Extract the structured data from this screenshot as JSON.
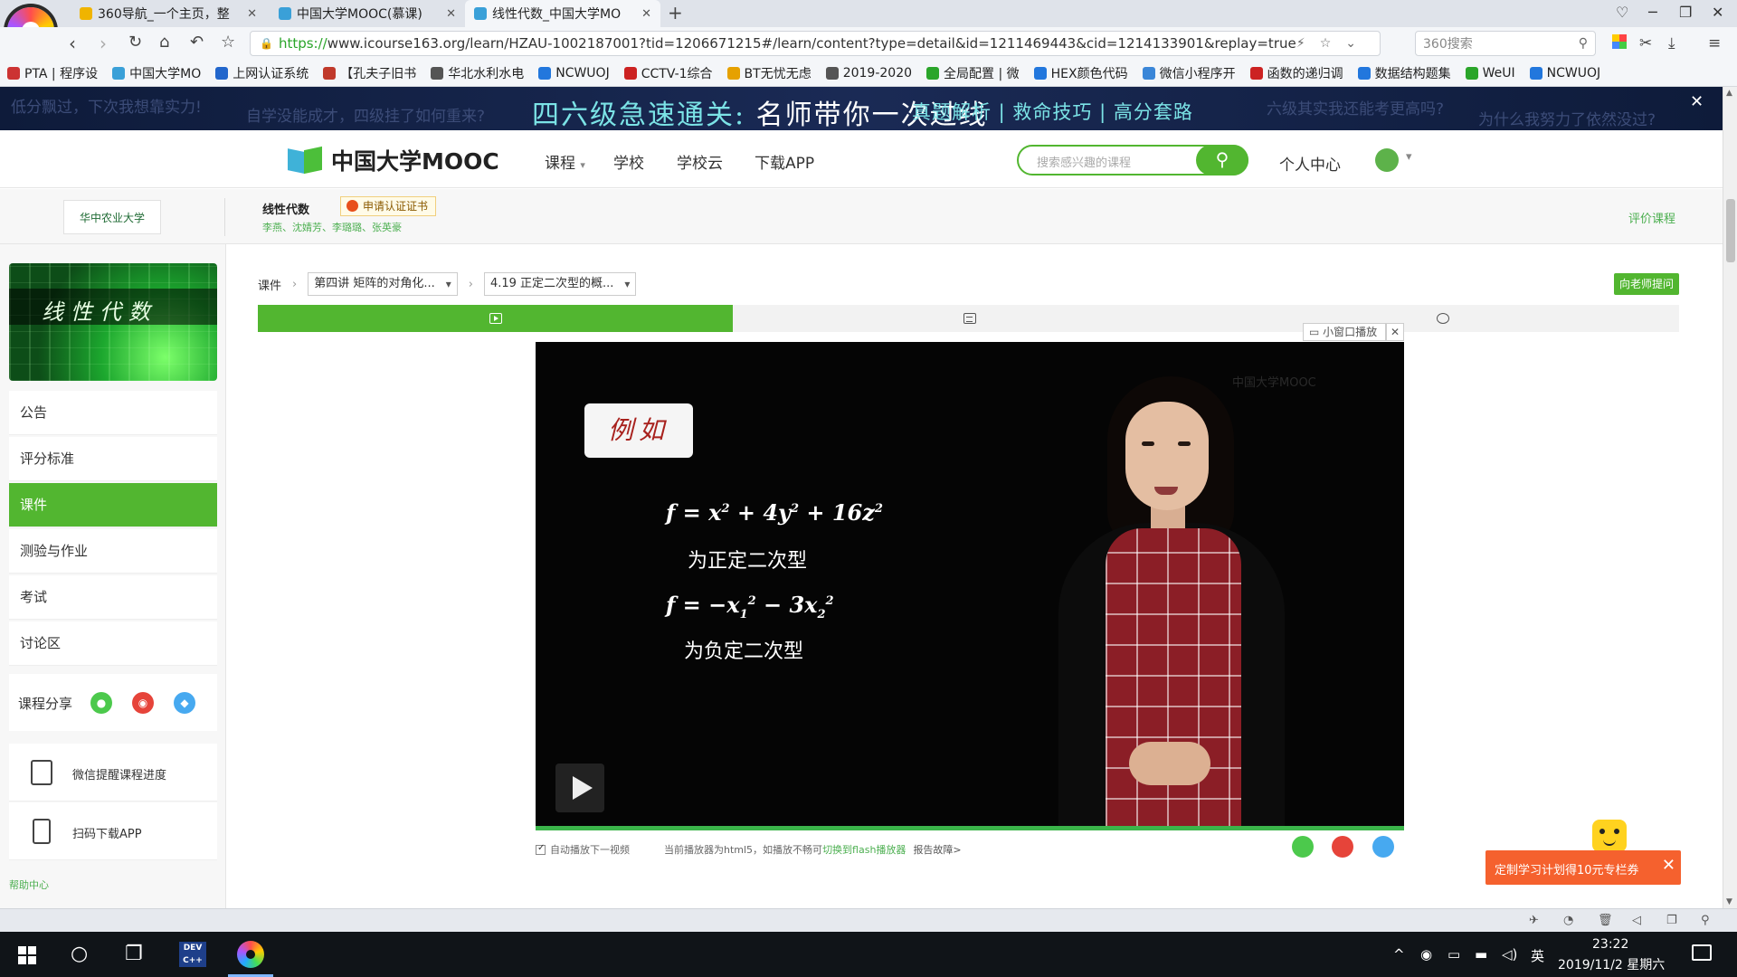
{
  "browser": {
    "tabs": [
      {
        "title": "360导航_一个主页，整",
        "active": false,
        "color": "#f0b400"
      },
      {
        "title": "中国大学MOOC(慕课)",
        "active": false,
        "color": "#3aa0d8"
      },
      {
        "title": "线性代数_中国大学MO",
        "active": true,
        "color": "#3aa0d8"
      }
    ],
    "new_tab": "+",
    "url_protocol": "https://",
    "url_rest": "www.icourse163.org/learn/HZAU-1002187001?tid=1206671215#/learn/content?type=detail&id=1211469443&cid=1214133901&replay=true",
    "search_placeholder": "360搜索",
    "bookmarks": [
      {
        "label": "PTA | 程序设",
        "color": "#cc3333"
      },
      {
        "label": "中国大学MO",
        "color": "#3aa0d8"
      },
      {
        "label": "上网认证系统",
        "color": "#2266cc"
      },
      {
        "label": "【孔夫子旧书",
        "color": "#c0392b"
      },
      {
        "label": "华北水利水电",
        "color": "#555555"
      },
      {
        "label": "NCWUOJ",
        "color": "#2277dd"
      },
      {
        "label": "CCTV-1综合",
        "color": "#cc2222"
      },
      {
        "label": "BT无忧无虑",
        "color": "#e6a100"
      },
      {
        "label": "2019-2020",
        "color": "#555555"
      },
      {
        "label": "全局配置 | 微",
        "color": "#2aa52a"
      },
      {
        "label": "HEX颜色代码",
        "color": "#2277dd"
      },
      {
        "label": "微信小程序开",
        "color": "#3a86d8"
      },
      {
        "label": "函数的递归调",
        "color": "#cc2222"
      },
      {
        "label": "数据结构题集",
        "color": "#2277dd"
      },
      {
        "label": "WeUI",
        "color": "#2aa52a"
      },
      {
        "label": "NCWUOJ",
        "color": "#2277dd"
      }
    ]
  },
  "ad": {
    "main_left": "四六级急速通关:",
    "main_right": "名师带你一次过线",
    "sub": "真题解析 | 救命技巧 | 高分套路",
    "floats": [
      "低分飘过，下次我想靠实力!",
      "自学没能成才，四级挂了如何重来?",
      "六级其实我还能考更高吗?",
      "为什么我努力了依然没过?"
    ],
    "close": "✕"
  },
  "header": {
    "logo_text": "中国大学MOOC",
    "nav": [
      "课程",
      "学校",
      "学校云",
      "下载APP"
    ],
    "search_placeholder": "搜索感兴趣的课程",
    "personal": "个人中心"
  },
  "course": {
    "school": "华中农业大学",
    "name": "线性代数",
    "cert_button": "申请认证证书",
    "teachers": "李燕、沈婧芳、李璐璐、张英豪",
    "rate": "评价课程",
    "cover_title": "线性代数"
  },
  "sidebar": {
    "items": [
      {
        "label": "公告",
        "active": false
      },
      {
        "label": "评分标准",
        "active": false
      },
      {
        "label": "课件",
        "active": true
      },
      {
        "label": "测验与作业",
        "active": false
      },
      {
        "label": "考试",
        "active": false
      },
      {
        "label": "讨论区",
        "active": false
      }
    ],
    "share_label": "课程分享",
    "tools": [
      "微信提醒课程进度",
      "扫码下载APP"
    ],
    "help": "帮助中心"
  },
  "content": {
    "crumb_root": "课件",
    "chapter": "第四讲 矩阵的对角化...",
    "lesson": "4.19 正定二次型的概...",
    "ask_teacher": "向老师提问",
    "mini_play": "小窗口播放",
    "mini_close": "✕"
  },
  "video": {
    "slide_tag": "例如",
    "desc1": "为正定二次型",
    "desc2": "为负定二次型",
    "watermark": "中国大学MOOC"
  },
  "player": {
    "autoplay": "自动播放下一视频",
    "note_prefix": "当前播放器为html5，如播放不畅可",
    "note_link": "切换到flash播放器",
    "report": "报告故障>"
  },
  "promo": {
    "text": "定制学习计划得10元专栏券",
    "close": "✕"
  },
  "taskbar": {
    "dev_label": "DEV C++",
    "ime": "英",
    "time": "23:22",
    "date": "2019/11/2 星期六"
  },
  "colors": {
    "brand_green": "#52b630",
    "wechat": "#4cc94c",
    "weibo": "#e6443a",
    "qq": "#47a9f0",
    "promo": "#f5612e"
  }
}
